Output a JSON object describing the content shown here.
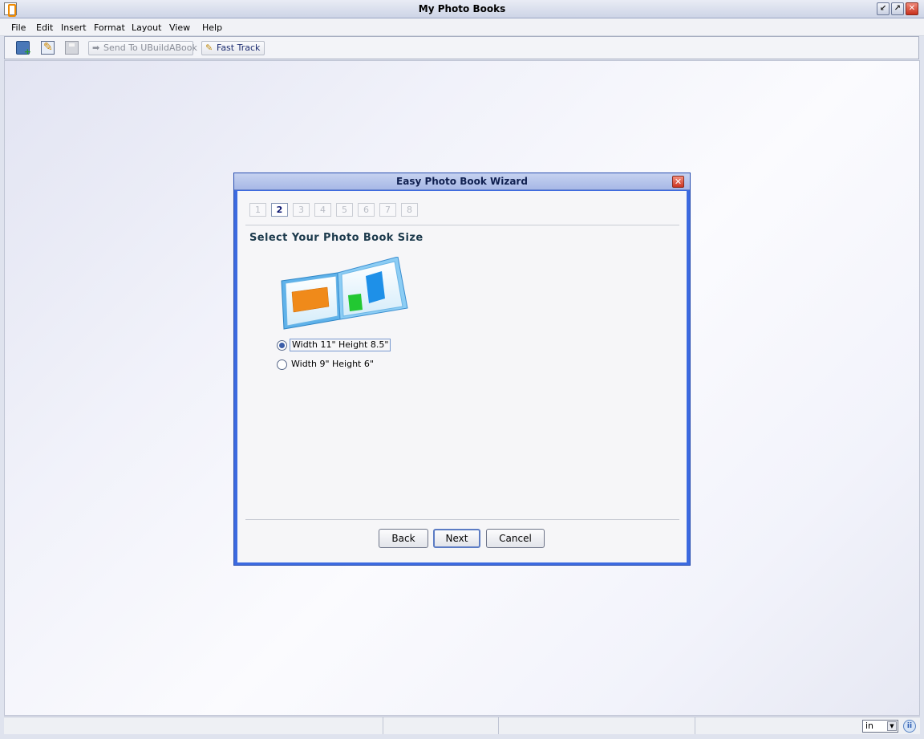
{
  "window": {
    "title": "My Photo Books"
  },
  "menu": [
    "File",
    "Edit",
    "Insert",
    "Format",
    "Layout",
    "View",
    "Help"
  ],
  "toolbar": {
    "send_label": "Send To  UBuildABook",
    "fast_label": "Fast Track"
  },
  "dialog": {
    "title": "Easy Photo Book Wizard",
    "steps": [
      "1",
      "2",
      "3",
      "4",
      "5",
      "6",
      "7",
      "8"
    ],
    "active_step": "2",
    "heading": "Select Your Photo Book Size",
    "options": [
      {
        "label": "Width 11\" Height 8.5\"",
        "selected": true
      },
      {
        "label": "Width 9\" Height 6\"",
        "selected": false
      }
    ],
    "buttons": {
      "back": "Back",
      "next": "Next",
      "cancel": "Cancel"
    }
  },
  "status": {
    "unit": "in"
  },
  "colors": {
    "dialog_frame": "#3c6ae0",
    "heading": "#1c3a4c",
    "workspace": "#f1f2fa"
  }
}
